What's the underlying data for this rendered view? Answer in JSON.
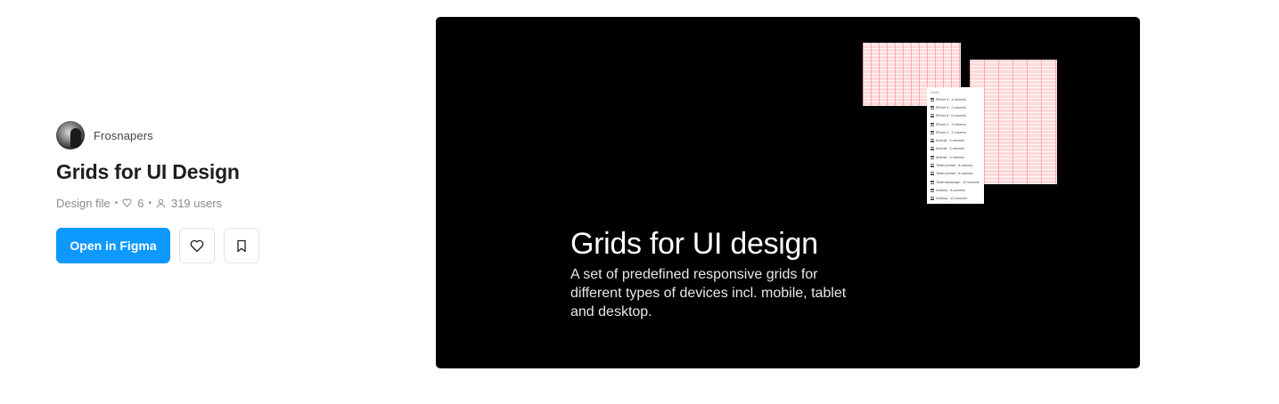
{
  "file": {
    "author": "Frosnapers",
    "title": "Grids for UI Design",
    "type_label": "Design file",
    "separator": "•",
    "likes": "6",
    "users": "319 users"
  },
  "actions": {
    "open_label": "Open in Figma",
    "like_icon": "heart-icon",
    "bookmark_icon": "bookmark-icon"
  },
  "preview": {
    "heading": "Grids for UI design",
    "description": "A set of predefined responsive grids for different types of devices incl. mobile, tablet and desktop.",
    "panel_header": "Grids",
    "panel_items": [
      "iPhone 8 - 4 columns",
      "iPhone 8 - 2 columns",
      "iPhone 8 - 6 columns",
      "iPhone X - 4 columns",
      "iPhone X - 2 columns",
      "Android - 4 columns",
      "Android - 2 columns",
      "Android - 6 columns",
      "Tablet portrait - 8 columns",
      "Tablet portrait - 6 columns",
      "Tablet landscape - 12 columns",
      "Desktop - 8 columns",
      "Desktop - 12 columns"
    ]
  },
  "colors": {
    "primary": "#0d99ff",
    "preview_bg": "#000000",
    "grid_pink": "#ffd9da"
  }
}
